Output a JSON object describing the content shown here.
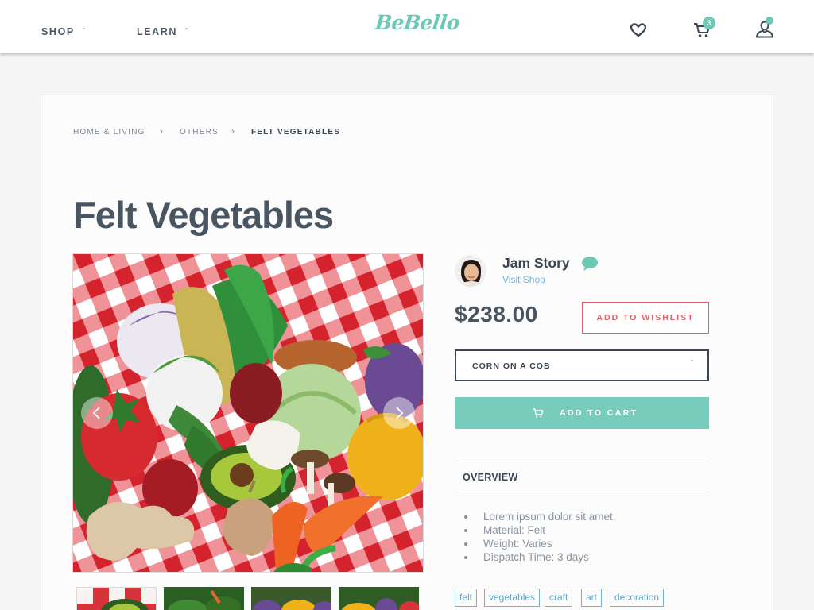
{
  "header": {
    "logo": "BeBello",
    "nav": [
      {
        "label": "SHOP"
      },
      {
        "label": "LEARN"
      }
    ],
    "cart_count": "3",
    "accent_color": "#6dc9b6"
  },
  "breadcrumb": [
    {
      "label": "HOME & LIVING"
    },
    {
      "label": "OTHERS"
    },
    {
      "label": "FELT VEGETABLES"
    }
  ],
  "product": {
    "title": "Felt Vegetables",
    "price": "$238.00",
    "wishlist_label": "ADD TO WISHLIST",
    "variant_selected": "CORN ON A COB",
    "add_to_cart_label": "ADD TO CART",
    "overview_title": "OVERVIEW",
    "overview_items": [
      "Lorem ipsum dolor sit amet",
      "Material: Felt",
      "Weight: Varies",
      "Dispatch Time: 3 days"
    ],
    "tags": [
      "felt",
      "vegetables",
      "craft",
      "art",
      "decoration"
    ],
    "thumbnail_count": 4
  },
  "seller": {
    "name": "Jam Story",
    "visit_label": "Visit Shop"
  },
  "icons": {
    "nav_dropdown": "chevron-down-icon",
    "wishlist": "heart-icon",
    "cart": "cart-icon",
    "account": "user-icon",
    "gallery_prev": "chevron-left-icon",
    "gallery_next": "chevron-right-icon",
    "message": "chat-bubble-icon"
  }
}
